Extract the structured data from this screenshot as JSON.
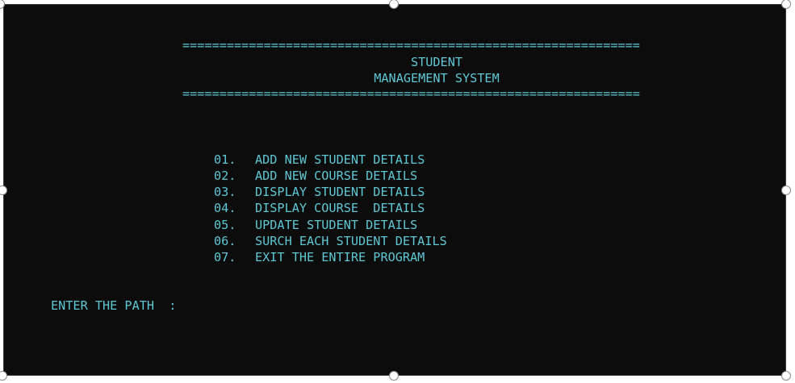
{
  "console": {
    "separator": "==============================================================",
    "title_line1": "STUDENT",
    "title_line2": "MANAGEMENT SYSTEM",
    "menu": [
      {
        "num": "01.",
        "label": "ADD NEW STUDENT DETAILS"
      },
      {
        "num": "02.",
        "label": "ADD NEW COURSE DETAILS"
      },
      {
        "num": "03.",
        "label": "DISPLAY STUDENT DETAILS"
      },
      {
        "num": "04.",
        "label": "DISPLAY COURSE  DETAILS"
      },
      {
        "num": "05.",
        "label": "UPDATE STUDENT DETAILS"
      },
      {
        "num": "06.",
        "label": "SURCH EACH STUDENT DETAILS"
      },
      {
        "num": "07.",
        "label": "EXIT THE ENTIRE PROGRAM"
      }
    ],
    "prompt": "ENTER THE PATH  :"
  },
  "colors": {
    "background": "#0c0c0c",
    "text": "#5fc7d4"
  }
}
